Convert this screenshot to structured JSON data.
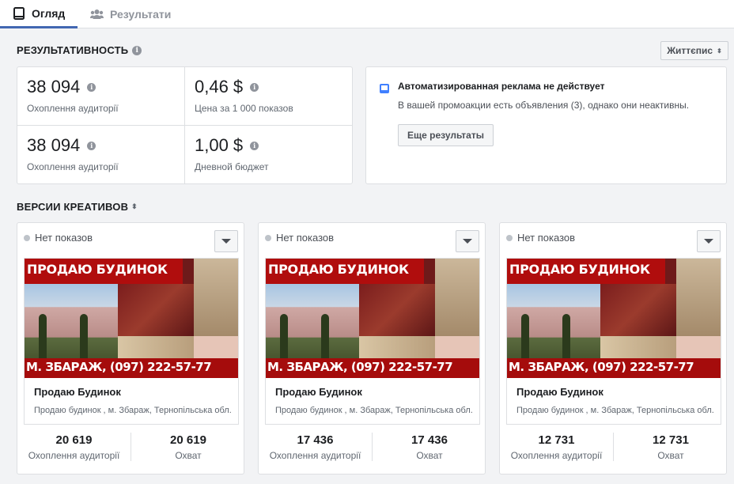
{
  "tabs": [
    {
      "label": "Огляд",
      "icon": "tablet-icon",
      "active": true
    },
    {
      "label": "Результати",
      "icon": "people-icon",
      "active": false
    }
  ],
  "performance": {
    "title": "РЕЗУЛЬТАТИВНОСТЬ",
    "period_button": "Життєпис",
    "metrics": [
      {
        "value": "38 094",
        "label": "Охоплення аудиторії"
      },
      {
        "value": "0,46 $",
        "label": "Цена за 1 000 показов"
      },
      {
        "value": "38 094",
        "label": "Охоплення аудиторії"
      },
      {
        "value": "1,00 $",
        "label": "Дневной бюджет"
      }
    ]
  },
  "notice": {
    "title": "Автоматизированная реклама не действует",
    "text": "В вашей промоакции есть объявления (3), однако они неактивны.",
    "button": "Еще результаты"
  },
  "creatives": {
    "title": "ВЕРСИИ КРЕАТИВОВ",
    "cards": [
      {
        "status": "Нет показов",
        "image_top_text": "ПРОДАЮ БУДИНОК",
        "image_bottom_text": "М. ЗБАРАЖ, (097) 222-57-77",
        "ad_title": "Продаю Будинок",
        "ad_text": "Продаю будинок , м. Збараж, Тернопільська обл.",
        "stat1_value": "20 619",
        "stat1_label": "Охоплення аудиторії",
        "stat2_value": "20 619",
        "stat2_label": "Охват"
      },
      {
        "status": "Нет показов",
        "image_top_text": "ПРОДАЮ БУДИНОК",
        "image_bottom_text": "М. ЗБАРАЖ, (097) 222-57-77",
        "ad_title": "Продаю Будинок",
        "ad_text": "Продаю будинок , м. Збараж, Тернопільська обл.",
        "stat1_value": "17 436",
        "stat1_label": "Охоплення аудиторії",
        "stat2_value": "17 436",
        "stat2_label": "Охват"
      },
      {
        "status": "Нет показов",
        "image_top_text": "ПРОДАЮ БУДИНОК",
        "image_bottom_text": "М. ЗБАРАЖ, (097) 222-57-77",
        "ad_title": "Продаю Будинок",
        "ad_text": "Продаю будинок , м. Збараж, Тернопільська обл.",
        "stat1_value": "12 731",
        "stat1_label": "Охоплення аудиторії",
        "stat2_value": "12 731",
        "stat2_label": "Охват"
      }
    ]
  },
  "colors": {
    "accent": "#4267b2",
    "notice_icon": "#4080ff",
    "status_dot": "#bec3c9"
  }
}
